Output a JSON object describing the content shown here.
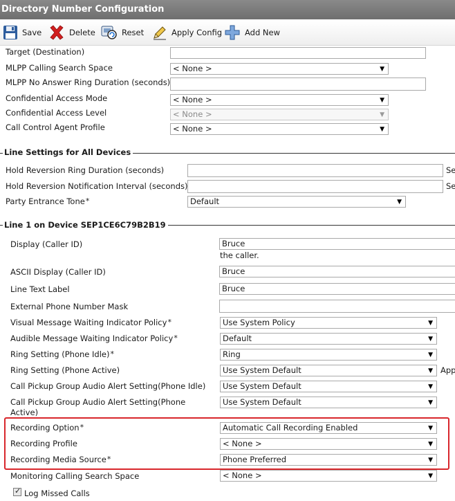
{
  "window_title": "Directory Number Configuration",
  "toolbar": {
    "save": "Save",
    "delete": "Delete",
    "reset": "Reset",
    "apply_config": "Apply Config",
    "add_new": "Add New"
  },
  "top_fields": {
    "target_destination": {
      "label": "Target (Destination)",
      "value": ""
    },
    "mlpp_css": {
      "label": "MLPP Calling Search Space",
      "value": "< None >"
    },
    "mlpp_no_answer": {
      "label": "MLPP No Answer Ring Duration (seconds)",
      "value": ""
    },
    "confidential_access_mode": {
      "label": "Confidential Access Mode",
      "value": "< None >"
    },
    "confidential_access_level": {
      "label": "Confidential Access Level",
      "value": "< None >"
    },
    "call_control_agent_profile": {
      "label": "Call Control Agent Profile",
      "value": "< None >"
    }
  },
  "line_settings": {
    "title": "Line Settings for All Devices",
    "hold_reversion_ring": {
      "label": "Hold Reversion Ring Duration (seconds)",
      "value": "",
      "side": "Se"
    },
    "hold_reversion_notification": {
      "label": "Hold Reversion Notification Interval (seconds)",
      "value": "",
      "side": "Se"
    },
    "party_entrance_tone": {
      "label": "Party Entrance Tone",
      "required": "*",
      "value": "Default"
    }
  },
  "line1": {
    "title": "Line 1 on Device SEP1CE6C79B2B19",
    "display": {
      "label": "Display (Caller ID)",
      "value": "Bruce",
      "hint": "the caller."
    },
    "ascii_display": {
      "label": "ASCII Display (Caller ID)",
      "value": "Bruce"
    },
    "line_text_label": {
      "label": "Line Text Label",
      "value": "Bruce"
    },
    "external_mask": {
      "label": "External Phone Number Mask",
      "value": ""
    },
    "visual_mwi": {
      "label": "Visual Message Waiting Indicator Policy",
      "required": "*",
      "value": "Use System Policy"
    },
    "audible_mwi": {
      "label": "Audible Message Waiting Indicator Policy",
      "required": "*",
      "value": "Default"
    },
    "ring_idle": {
      "label": "Ring Setting (Phone Idle)",
      "required": "*",
      "value": "Ring"
    },
    "ring_active": {
      "label": "Ring Setting (Phone Active)",
      "value": "Use System Default",
      "side": "App"
    },
    "pickup_idle": {
      "label": "Call Pickup Group Audio Alert Setting(Phone Idle)",
      "value": "Use System Default"
    },
    "pickup_active": {
      "label_line1": "Call Pickup Group Audio Alert Setting(Phone",
      "label_line2": "Active)",
      "value": "Use System Default"
    },
    "recording_option": {
      "label": "Recording Option",
      "required": "*",
      "value": "Automatic Call Recording Enabled"
    },
    "recording_profile": {
      "label": "Recording Profile",
      "value": "< None >"
    },
    "recording_media_source": {
      "label": "Recording Media Source",
      "required": "*",
      "value": "Phone Preferred"
    },
    "monitoring_css": {
      "label": "Monitoring Calling Search Space",
      "value": "< None >"
    },
    "log_missed_calls": {
      "label": "Log Missed Calls",
      "checked": true
    }
  },
  "colors": {
    "highlight": "#d8262b",
    "titlebar": "#7a7a7a"
  }
}
